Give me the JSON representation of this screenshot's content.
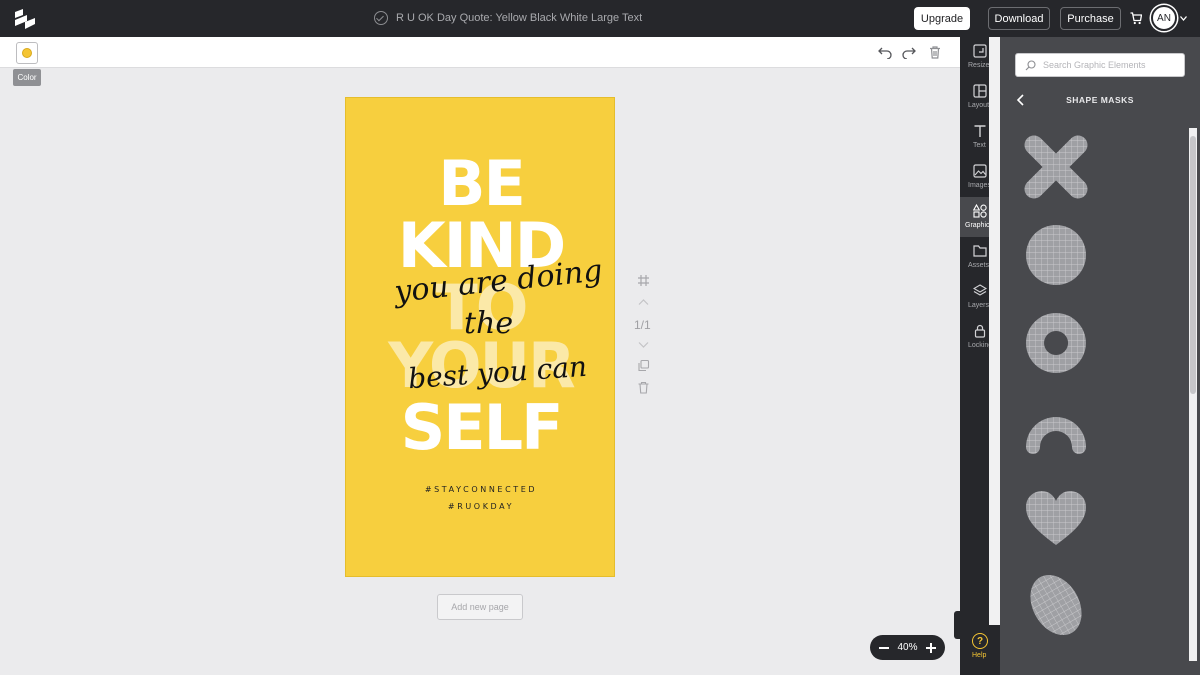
{
  "header": {
    "doc_title": "R U OK Day Quote: Yellow Black White Large Text",
    "upgrade_label": "Upgrade",
    "download_label": "Download",
    "purchase_label": "Purchase",
    "avatar_initials": "AN"
  },
  "toolbar": {
    "color_tooltip": "Color",
    "swatch_color": "#f5c533"
  },
  "design": {
    "background_color": "#f7cf3e",
    "big_words": [
      "BE",
      "KIND",
      "TO",
      "YOUR",
      "SELF"
    ],
    "script_lines": [
      "you are doing",
      "the",
      "best you can"
    ],
    "hashtags": [
      "#STAYCONNECTED",
      "#RUOKDAY"
    ]
  },
  "page_controls": {
    "page_indicator": "1/1",
    "add_page_label": "Add new page"
  },
  "zoom": {
    "level": "40%"
  },
  "sidenav": {
    "items": [
      {
        "label": "Resize",
        "icon": "resize-icon"
      },
      {
        "label": "Layouts",
        "icon": "layouts-icon"
      },
      {
        "label": "Text",
        "icon": "text-icon"
      },
      {
        "label": "Images",
        "icon": "images-icon"
      },
      {
        "label": "Graphics",
        "icon": "graphics-icon"
      },
      {
        "label": "Assets",
        "icon": "assets-icon"
      },
      {
        "label": "Layers",
        "icon": "layers-icon"
      },
      {
        "label": "Locking",
        "icon": "lock-icon"
      }
    ],
    "active": "Graphics",
    "help_label": "Help"
  },
  "panel": {
    "search_placeholder": "Search Graphic Elements",
    "title": "SHAPE MASKS",
    "shapes": [
      "x-mask",
      "circle-mask",
      "ring-mask",
      "arch-mask",
      "heart-mask",
      "oval-mask"
    ]
  }
}
